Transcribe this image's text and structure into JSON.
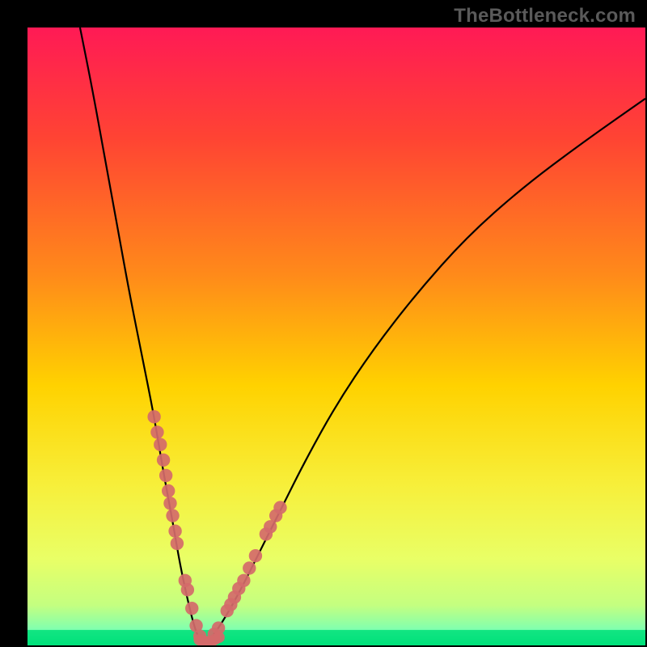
{
  "watermark": "TheBottleneck.com",
  "chart_data": {
    "type": "line",
    "title": "",
    "xlabel": "",
    "ylabel": "",
    "xlim": [
      0,
      100
    ],
    "ylim": [
      0,
      100
    ],
    "gradient_stops": [
      {
        "offset": 0,
        "color": "#ff1a55"
      },
      {
        "offset": 0.18,
        "color": "#ff4433"
      },
      {
        "offset": 0.4,
        "color": "#ff8a1a"
      },
      {
        "offset": 0.58,
        "color": "#ffd200"
      },
      {
        "offset": 0.74,
        "color": "#f7ef3a"
      },
      {
        "offset": 0.86,
        "color": "#e9ff66"
      },
      {
        "offset": 0.935,
        "color": "#c4ff80"
      },
      {
        "offset": 0.975,
        "color": "#7fffb0"
      },
      {
        "offset": 1.0,
        "color": "#00e07a"
      }
    ],
    "series": [
      {
        "name": "left-curve",
        "x": [
          8.5,
          10.5,
          12.5,
          14.5,
          16.5,
          18.5,
          20.5,
          22.0,
          23.5,
          24.7,
          26.0,
          27.0,
          27.8,
          28.5
        ],
        "y": [
          100,
          90,
          79,
          68,
          57,
          47,
          37,
          28,
          20,
          13,
          7,
          3,
          1,
          0
        ]
      },
      {
        "name": "right-curve",
        "x": [
          28.5,
          30.0,
          32.0,
          34.5,
          37.5,
          41.0,
          45.0,
          50.0,
          56.0,
          63.0,
          71.0,
          80.0,
          90.0,
          100.0
        ],
        "y": [
          0,
          1.5,
          4.5,
          9,
          15,
          22,
          30,
          39,
          48,
          57,
          66,
          74,
          81.5,
          88.5
        ]
      }
    ],
    "green_band": {
      "y0": 0,
      "y1": 2.5
    },
    "highlight_dots": {
      "color": "#d46a6a",
      "left": [
        [
          20.5,
          37
        ],
        [
          21.0,
          34.5
        ],
        [
          21.5,
          32.5
        ],
        [
          22.0,
          30
        ],
        [
          22.4,
          27.5
        ],
        [
          22.8,
          25
        ],
        [
          23.1,
          23
        ],
        [
          23.5,
          21
        ],
        [
          23.9,
          18.5
        ],
        [
          24.2,
          16.5
        ],
        [
          25.5,
          10.5
        ],
        [
          25.9,
          9.0
        ],
        [
          26.6,
          6.0
        ],
        [
          27.3,
          3.2
        ],
        [
          27.9,
          1.5
        ]
      ],
      "right": [
        [
          30.2,
          1.8
        ],
        [
          30.9,
          2.8
        ],
        [
          32.3,
          5.6
        ],
        [
          32.9,
          6.6
        ],
        [
          33.5,
          7.8
        ],
        [
          34.2,
          9.2
        ],
        [
          35.0,
          10.5
        ],
        [
          35.9,
          12.5
        ],
        [
          36.9,
          14.5
        ],
        [
          38.6,
          18.0
        ],
        [
          39.3,
          19.2
        ],
        [
          40.2,
          21.0
        ],
        [
          40.9,
          22.3
        ]
      ],
      "bottom": [
        [
          27.8,
          0.9
        ],
        [
          28.3,
          0.7
        ],
        [
          28.9,
          0.6
        ],
        [
          29.4,
          0.6
        ],
        [
          29.9,
          0.7
        ],
        [
          30.4,
          1.0
        ],
        [
          31.0,
          1.3
        ]
      ]
    }
  }
}
